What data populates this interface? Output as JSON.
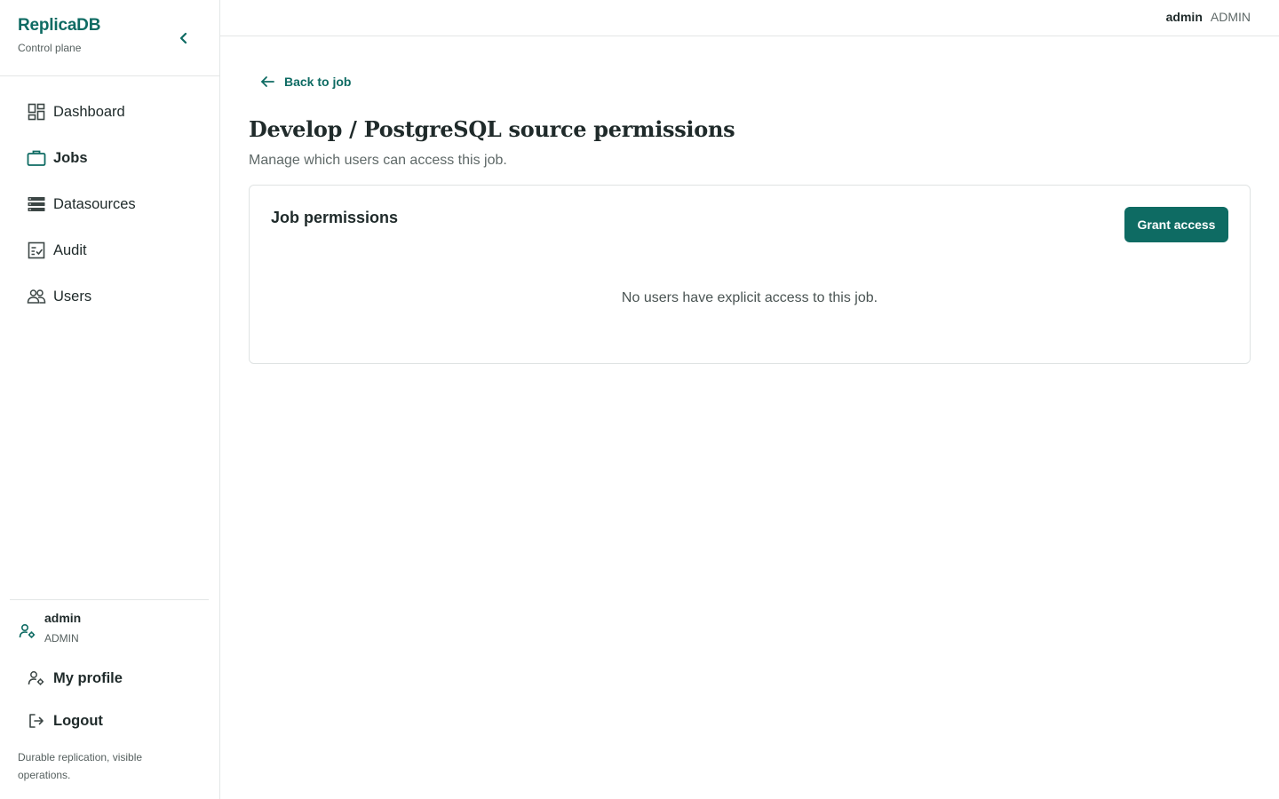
{
  "brand": {
    "name": "ReplicaDB",
    "subtitle": "Control plane"
  },
  "sidebar": {
    "items": [
      {
        "label": "Dashboard",
        "icon": "dashboard-icon",
        "active": false
      },
      {
        "label": "Jobs",
        "icon": "briefcase-icon",
        "active": true
      },
      {
        "label": "Datasources",
        "icon": "datasource-icon",
        "active": false
      },
      {
        "label": "Audit",
        "icon": "audit-icon",
        "active": false
      },
      {
        "label": "Users",
        "icon": "users-icon",
        "active": false
      }
    ],
    "user": {
      "name": "admin",
      "role": "ADMIN"
    },
    "bottom_items": [
      {
        "label": "My profile",
        "icon": "user-gear-icon"
      },
      {
        "label": "Logout",
        "icon": "logout-icon"
      }
    ],
    "tagline": "Durable replication, visible operations."
  },
  "topbar": {
    "user_name": "admin",
    "user_role": "ADMIN"
  },
  "main": {
    "back_label": "Back to job",
    "title": "Develop / PostgreSQL source permissions",
    "subtitle": "Manage which users can access this job.",
    "card": {
      "title": "Job permissions",
      "grant_label": "Grant access",
      "empty_message": "No users have explicit access to this job."
    }
  },
  "colors": {
    "accent": "#0e6b63",
    "text": "#1f2a2a",
    "muted": "#5f6968",
    "border": "#e3e6e6"
  }
}
